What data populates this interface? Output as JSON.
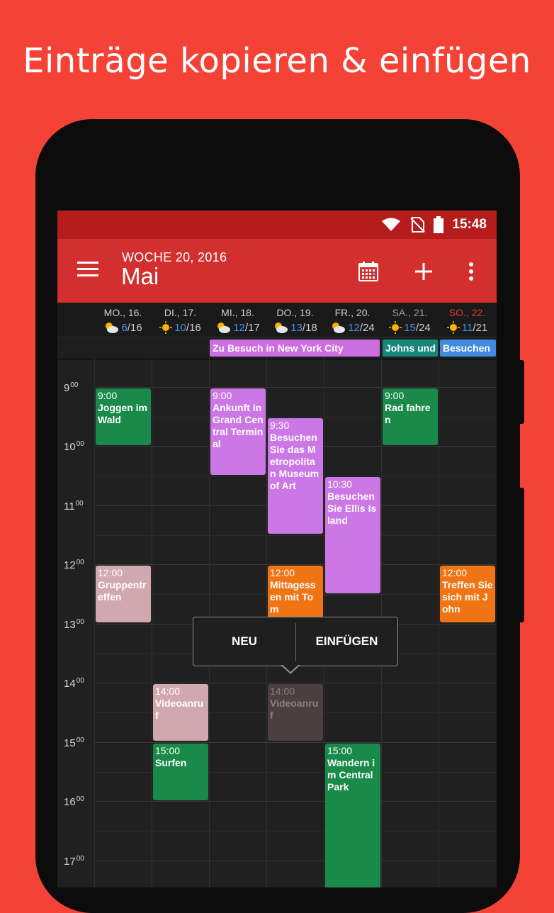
{
  "promo": {
    "headline": "Einträge kopieren & einfügen"
  },
  "status_bar": {
    "time": "15:48"
  },
  "app_bar": {
    "week_label": "WOCHE 20, 2016",
    "month_title": "Mai"
  },
  "days": [
    {
      "name": "MO., 16.",
      "lo": "6",
      "hi": "16",
      "weather": "partly-cloudy-icon",
      "name_color": "#cfcfcf"
    },
    {
      "name": "DI., 17.",
      "lo": "10",
      "hi": "16",
      "weather": "sun-icon",
      "name_color": "#cfcfcf"
    },
    {
      "name": "MI., 18.",
      "lo": "12",
      "hi": "17",
      "weather": "partly-cloudy-icon",
      "name_color": "#cfcfcf"
    },
    {
      "name": "DO., 19.",
      "lo": "13",
      "hi": "18",
      "weather": "partly-cloudy-icon",
      "name_color": "#cfcfcf"
    },
    {
      "name": "FR., 20.",
      "lo": "12",
      "hi": "24",
      "weather": "partly-cloudy-icon",
      "name_color": "#cfcfcf"
    },
    {
      "name": "SA., 21.",
      "lo": "15",
      "hi": "24",
      "weather": "sun-icon",
      "name_color": "#9e9e9e"
    },
    {
      "name": "SO., 22.",
      "lo": "11",
      "hi": "21",
      "weather": "sun-icon",
      "name_color": "#e53935"
    }
  ],
  "allday_events": [
    {
      "title": "Zu Besuch in New York City",
      "color": "#cc6ee0"
    },
    {
      "title": "Johns und",
      "color": "#14877a"
    },
    {
      "title": "Besuchen",
      "color": "#3f8bdf"
    }
  ],
  "hours": [
    "9",
    "10",
    "11",
    "12",
    "13",
    "14",
    "15",
    "16",
    "17"
  ],
  "events": [
    {
      "time": "9:00",
      "title": "Joggen im Wald",
      "color": "#1a8a4a"
    },
    {
      "time": "9:00",
      "title": "Ankunft in Grand Central Terminal",
      "color": "#cc77e6"
    },
    {
      "time": "9:30",
      "title": "Besuchen Sie das Metropolitan Museum of Art",
      "color": "#cc77e6"
    },
    {
      "time": "10:30",
      "title": "Besuchen Sie Ellis Island",
      "color": "#cc77e6"
    },
    {
      "time": "9:00",
      "title": "Rad fahren",
      "color": "#1a8a4a"
    },
    {
      "time": "12:00",
      "title": "Gruppentreffen",
      "color": "#d2a8b0"
    },
    {
      "time": "12:00",
      "title": "Mittagessen mit Tom",
      "color": "#f07414"
    },
    {
      "time": "12:00",
      "title": "Treffen Sie sich mit John",
      "color": "#f07414"
    },
    {
      "time": "14:00",
      "title": "Videoanruf",
      "color": "#d2a8b0"
    },
    {
      "time": "14:00",
      "title": "Videoanruf",
      "color": "#4a3f41"
    },
    {
      "time": "15:00",
      "title": "Surfen",
      "color": "#1a8a4a"
    },
    {
      "time": "15:00",
      "title": "Wandern im Central Park",
      "color": "#1a8a4a"
    }
  ],
  "context_menu": {
    "new_label": "NEU",
    "paste_label": "EINFÜGEN"
  }
}
